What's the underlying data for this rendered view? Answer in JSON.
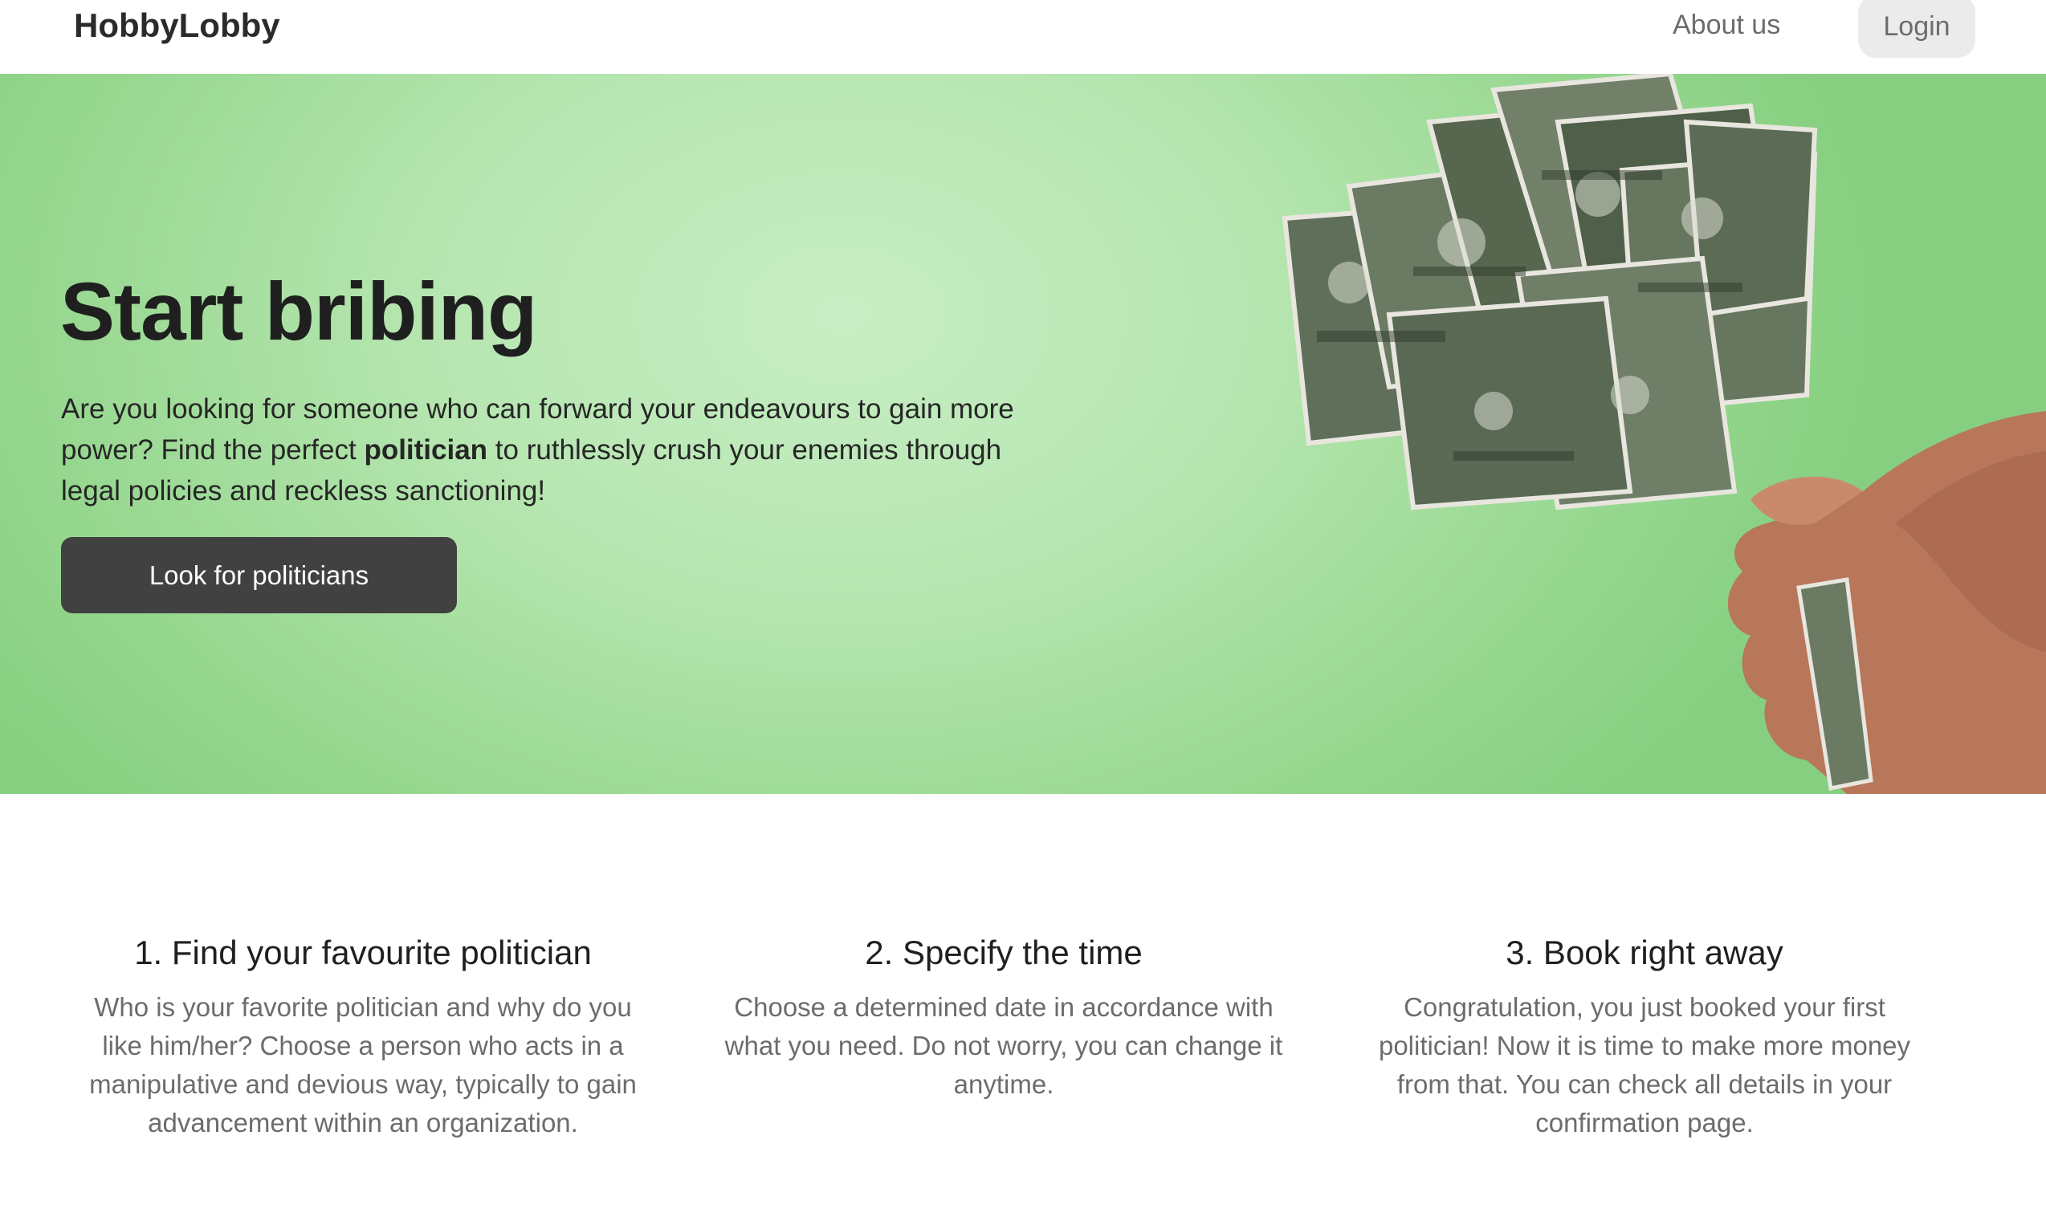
{
  "navbar": {
    "brand": "HobbyLobby",
    "about_label": "About us",
    "login_label": "Login"
  },
  "hero": {
    "title": "Start bribing",
    "text_before": "Are you looking for someone who can forward your endeavours to gain more power? Find the perfect ",
    "text_bold": "politician",
    "text_after": " to ruthlessly crush your enemies through legal policies and reckless sanctioning!",
    "cta_label": "Look for politicians",
    "image_subject": "hand-holding-dollar-bills"
  },
  "steps": [
    {
      "title": "1. Find your favourite politician",
      "text": "Who is your favorite politician and why do you like him/her? Choose a person who acts in a manipulative and devious way, typically to gain advancement within an organization."
    },
    {
      "title": "2. Specify the time",
      "text": "Choose a determined date in accordance with what you need. Do not worry, you can change it anytime."
    },
    {
      "title": "3. Book right away",
      "text": "Congratulation, you just booked your first politician! Now it is time to make more money from that. You can check all details in your confirmation page."
    }
  ],
  "colors": {
    "hero_green": "#b6e6b0",
    "button_dark": "#414141",
    "login_bg": "#ebebeb"
  }
}
